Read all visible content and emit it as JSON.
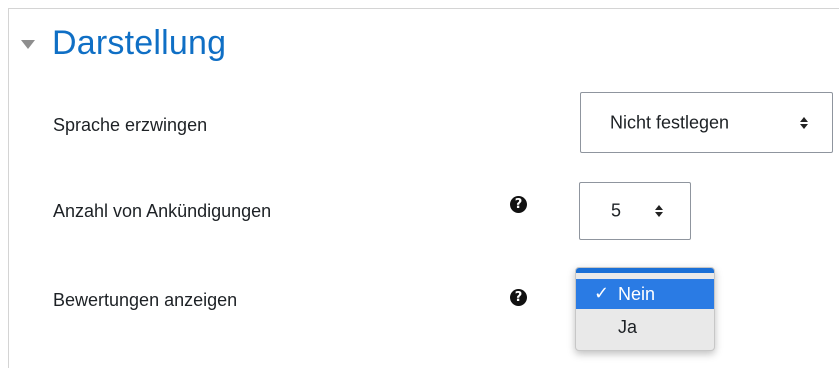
{
  "section": {
    "title": "Darstellung",
    "caret_icon": "caret-down-icon"
  },
  "rows": [
    {
      "label": "Sprache erzwingen",
      "select_value": "Nicht festlegen"
    },
    {
      "label": "Anzahl von Ankündigungen",
      "help_icon": "question-circle-icon",
      "select_value": "5"
    },
    {
      "label": "Bewertungen anzeigen",
      "help_icon": "question-circle-icon"
    }
  ],
  "dropdown": {
    "options": [
      {
        "label": "Nein",
        "selected": true,
        "check": "✓"
      },
      {
        "label": "Ja",
        "selected": false
      }
    ]
  },
  "colors": {
    "title": "#0f6fc5",
    "selected_option_bg": "#2a7be4",
    "dropdown_border": "#1a6fd6"
  }
}
